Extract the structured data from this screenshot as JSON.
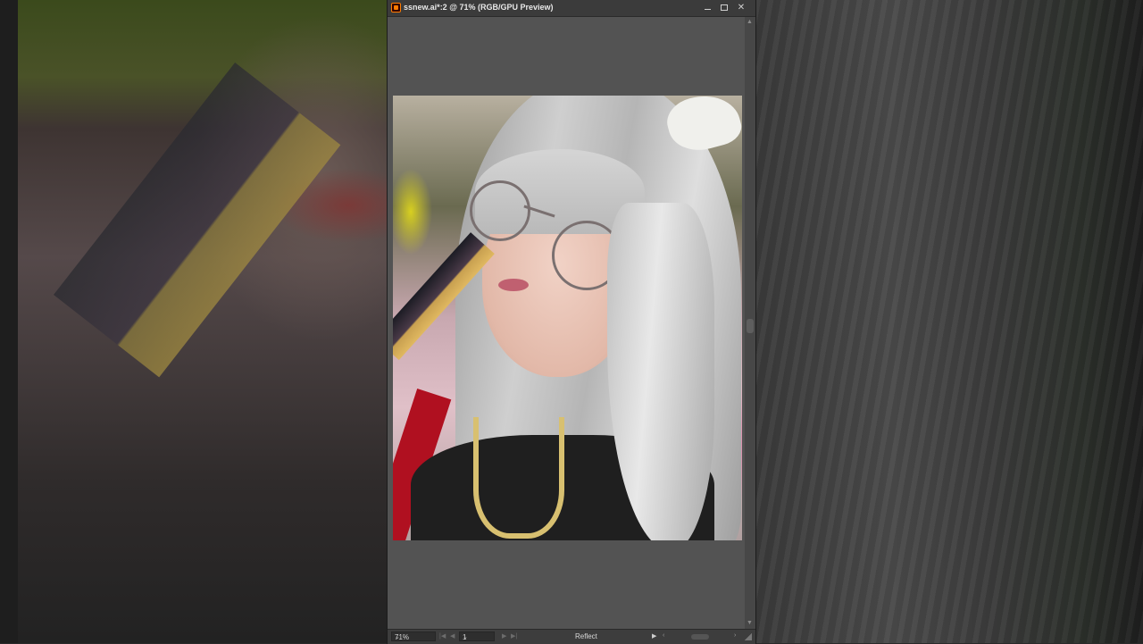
{
  "window": {
    "title": "ssnew.ai*:2 @ 71% (RGB/GPU Preview)",
    "buttons": {
      "minimize": "—",
      "maximize": "□",
      "close": "✕"
    }
  },
  "statusbar": {
    "zoom": "71%",
    "page": "1",
    "status": "Reflect"
  },
  "colors": {
    "canvas": "#535353",
    "titlebar": "#3b3b3b",
    "accent_orange": "#ff7c00"
  },
  "icons": [
    "illustrator-app-icon",
    "chevron-down-icon",
    "first-page-icon",
    "prev-page-icon",
    "next-page-icon",
    "last-page-icon",
    "play-icon",
    "scroll-left-icon",
    "scroll-right-icon",
    "resize-grip-icon"
  ]
}
